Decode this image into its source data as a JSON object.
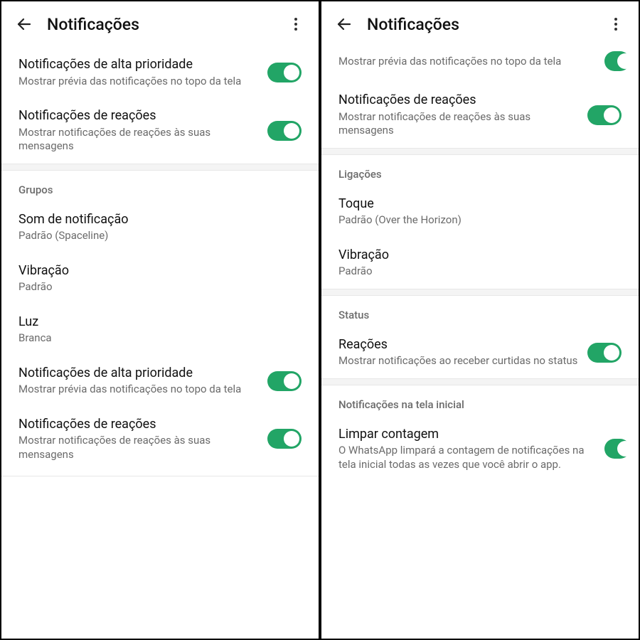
{
  "header": {
    "title": "Notificações"
  },
  "left": {
    "items": [
      {
        "title": "Notificações de alta prioridade",
        "sub": "Mostrar prévia das notificações no topo da tela",
        "toggle": true
      },
      {
        "title": "Notificações de reações",
        "sub": "Mostrar notificações de reações às suas mensagens",
        "toggle": true
      }
    ],
    "groups_header": "Grupos",
    "groups": [
      {
        "title": "Som de notificação",
        "sub": "Padrão (Spaceline)"
      },
      {
        "title": "Vibração",
        "sub": "Padrão"
      },
      {
        "title": "Luz",
        "sub": "Branca"
      },
      {
        "title": "Notificações de alta prioridade",
        "sub": "Mostrar prévia das notificações no topo da tela",
        "toggle": true
      },
      {
        "title": "Notificações de reações",
        "sub": "Mostrar notificações de reações às suas mensagens",
        "toggle": true
      }
    ]
  },
  "right": {
    "top_items": [
      {
        "title": "",
        "sub": "Mostrar prévia das notificações no topo da tela",
        "toggle": true,
        "partial": true
      },
      {
        "title": "Notificações de reações",
        "sub": "Mostrar notificações de reações às suas mensagens",
        "toggle": true
      }
    ],
    "calls_header": "Ligações",
    "calls": [
      {
        "title": "Toque",
        "sub": "Padrão (Over the Horizon)"
      },
      {
        "title": "Vibração",
        "sub": "Padrão"
      }
    ],
    "status_header": "Status",
    "status": [
      {
        "title": "Reações",
        "sub": "Mostrar notificações ao receber curtidas no status",
        "toggle": true
      }
    ],
    "home_header": "Notificações na tela inicial",
    "home": [
      {
        "title": "Limpar contagem",
        "sub": "O WhatsApp limpará a contagem de notificações na tela inicial todas as vezes que você abrir o app.",
        "toggle": true,
        "partial": true
      }
    ]
  }
}
